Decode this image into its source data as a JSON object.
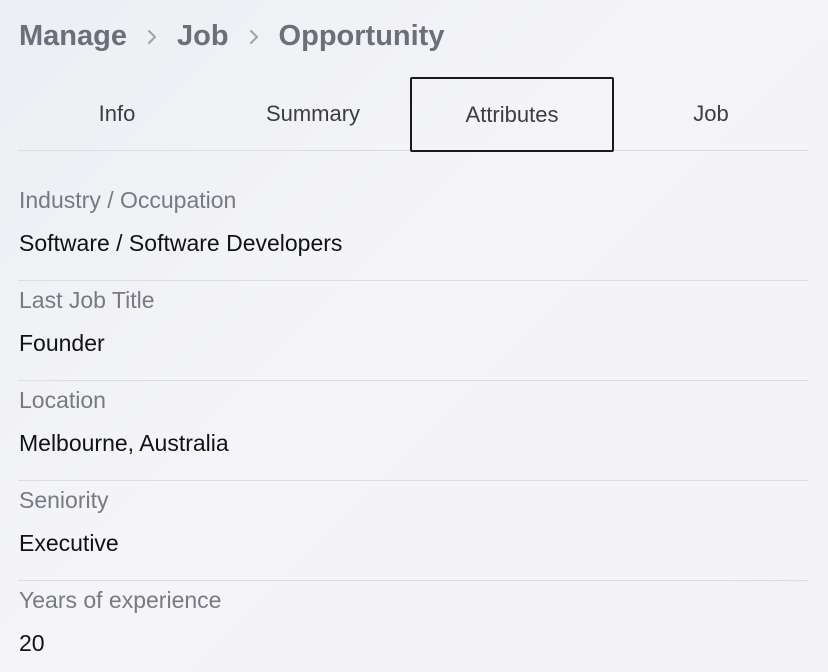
{
  "breadcrumb": {
    "items": [
      "Manage",
      "Job",
      "Opportunity"
    ]
  },
  "tabs": [
    {
      "label": "Info"
    },
    {
      "label": "Summary"
    },
    {
      "label": "Attributes",
      "selected": true
    },
    {
      "label": "Job"
    }
  ],
  "fields": [
    {
      "label": "Industry / Occupation",
      "value": "Software / Software Developers"
    },
    {
      "label": "Last Job Title",
      "value": "Founder"
    },
    {
      "label": "Location",
      "value": "Melbourne, Australia"
    },
    {
      "label": "Seniority",
      "value": "Executive"
    },
    {
      "label": "Years of experience",
      "value": "20"
    }
  ],
  "colors": {
    "breadcrumb_text": "#6b6f7a",
    "label_text": "#777a82",
    "value_text": "#111214",
    "active_tab_border": "#1a1a1a",
    "divider": "#dcdde1"
  }
}
